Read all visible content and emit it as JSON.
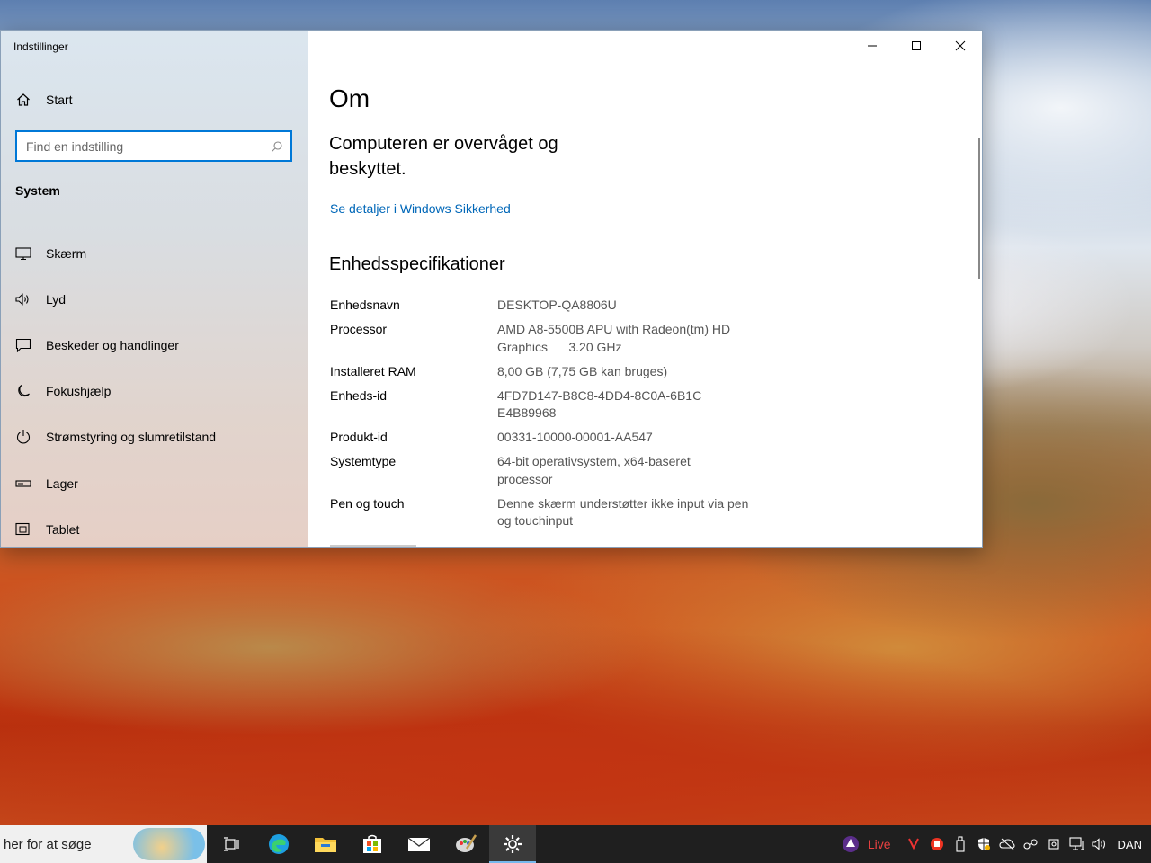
{
  "window": {
    "app_title": "Indstillinger",
    "controls": {
      "minimize": "—",
      "maximize": "☐",
      "close": "✕"
    }
  },
  "sidebar": {
    "home_label": "Start",
    "search_placeholder": "Find en indstilling",
    "section_title": "System",
    "items": [
      {
        "label": "Skærm",
        "icon": "monitor-icon"
      },
      {
        "label": "Lyd",
        "icon": "speaker-icon"
      },
      {
        "label": "Beskeder og handlinger",
        "icon": "notification-icon"
      },
      {
        "label": "Fokushjælp",
        "icon": "moon-icon"
      },
      {
        "label": "Strømstyring og slumretilstand",
        "icon": "power-icon"
      },
      {
        "label": "Lager",
        "icon": "storage-icon"
      },
      {
        "label": "Tablet",
        "icon": "tablet-icon"
      }
    ]
  },
  "main": {
    "title": "Om",
    "protection_text": "Computeren er overvåget og beskyttet.",
    "security_link": "Se detaljer i Windows Sikkerhed",
    "specs_title": "Enhedsspecifikationer",
    "specs": [
      {
        "label": "Enhedsnavn",
        "value": "DESKTOP-QA8806U"
      },
      {
        "label": "Processor",
        "value": "AMD A8-5500B APU with Radeon(tm) HD Graphics      3.20 GHz"
      },
      {
        "label": "Installeret RAM",
        "value": "8,00 GB (7,75 GB kan bruges)"
      },
      {
        "label": "Enheds-id",
        "value": "4FD7D147-B8C8-4DD4-8C0A-6B1CE4B89968"
      },
      {
        "label": "Produkt-id",
        "value": "00331-10000-00001-AA547"
      },
      {
        "label": "Systemtype",
        "value": "64-bit operativsystem, x64-baseret processor"
      },
      {
        "label": "Pen og touch",
        "value": "Denne skærm understøtter ikke input via pen og touchinput"
      }
    ]
  },
  "taskbar": {
    "search_text": "her for at søge",
    "apps": [
      "task-view-icon",
      "edge-icon",
      "file-explorer-icon",
      "store-icon",
      "mail-icon",
      "paint-icon",
      "settings-icon"
    ],
    "tray": {
      "live_label": "Live",
      "language": "DAN"
    }
  }
}
